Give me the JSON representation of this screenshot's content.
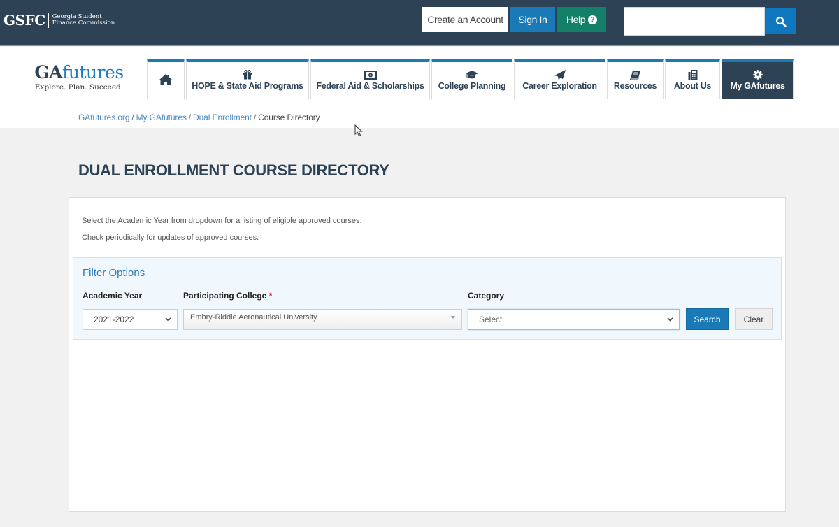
{
  "header": {
    "logo_mark": "GSFC",
    "logo_name_line1": "Georgia Student",
    "logo_name_line2": "Finance Commission",
    "create_account": "Create an Account",
    "sign_in": "Sign In",
    "help": "Help",
    "search_placeholder": "",
    "colors": {
      "bar": "#2e4256",
      "sign_in": "#1a7ab8",
      "help": "#14806a"
    }
  },
  "brand": {
    "ga": "GA",
    "futures": "futures",
    "tagline": "Explore. Plan. Succeed."
  },
  "nav": {
    "items": [
      {
        "label": "",
        "icon": "home-icon"
      },
      {
        "label": "HOPE & State Aid Programs",
        "icon": "gift-icon"
      },
      {
        "label": "Federal Aid & Scholarships",
        "icon": "money-icon"
      },
      {
        "label": "College Planning",
        "icon": "graduation-cap-icon"
      },
      {
        "label": "Career Exploration",
        "icon": "paper-plane-icon"
      },
      {
        "label": "Resources",
        "icon": "book-icon"
      },
      {
        "label": "About Us",
        "icon": "fax-icon"
      },
      {
        "label": "My GAfutures",
        "icon": "gear-icon",
        "active": true
      }
    ]
  },
  "breadcrumb": {
    "items": [
      "GAfutures.org",
      "My GAfutures",
      "Dual Enrollment"
    ],
    "current": "Course Directory",
    "separator": "/"
  },
  "main": {
    "title": "DUAL ENROLLMENT COURSE DIRECTORY",
    "intro_line1": "Select the Academic Year from dropdown for a listing of eligible approved courses.",
    "intro_line2": "Check periodically for updates of approved courses."
  },
  "filter": {
    "title": "Filter Options",
    "academic_year_label": "Academic Year",
    "academic_year_value": "2021-2022",
    "college_label": "Participating College",
    "college_required_mark": "*",
    "college_value": "Embry-Riddle Aeronautical University",
    "category_label": "Category",
    "category_value": "Select",
    "search_button": "Search",
    "clear_button": "Clear"
  }
}
